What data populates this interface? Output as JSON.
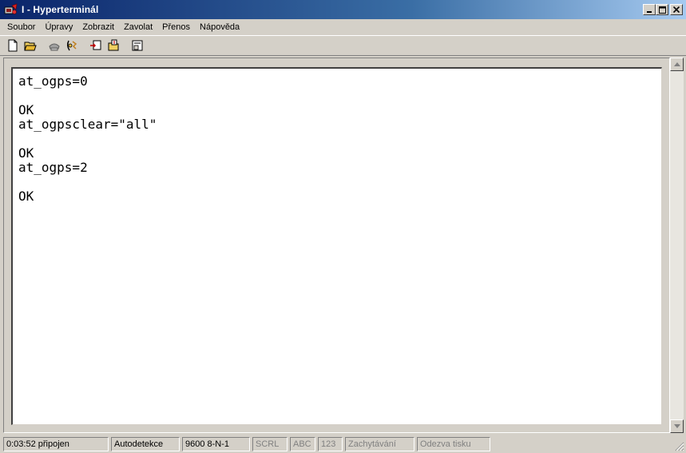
{
  "window": {
    "title": "I - Hyperterminál",
    "minimize_label": "_",
    "maximize_label": "□",
    "close_label": "✕"
  },
  "menu": {
    "items": [
      "Soubor",
      "Úpravy",
      "Zobrazit",
      "Zavolat",
      "Přenos",
      "Nápověda"
    ]
  },
  "toolbar": {
    "buttons": [
      "new-icon",
      "open-icon",
      "connect-icon",
      "disconnect-icon",
      "send-icon",
      "receive-icon",
      "properties-icon"
    ]
  },
  "terminal": {
    "lines": [
      "at_ogps=0",
      "",
      "OK",
      "at_ogpsclear=\"all\"",
      "",
      "OK",
      "at_ogps=2",
      "",
      "OK"
    ]
  },
  "statusbar": {
    "connection": "0:03:52 připojen",
    "detection": "Autodetekce",
    "port_settings": "9600 8-N-1",
    "scrl": "SCRL",
    "caps": "ABC",
    "num": "123",
    "capture": "Zachytávání",
    "print_echo": "Odezva tisku"
  },
  "colors": {
    "title_start": "#0a246a",
    "title_end": "#a6caf0",
    "chrome": "#d4d0c8"
  }
}
